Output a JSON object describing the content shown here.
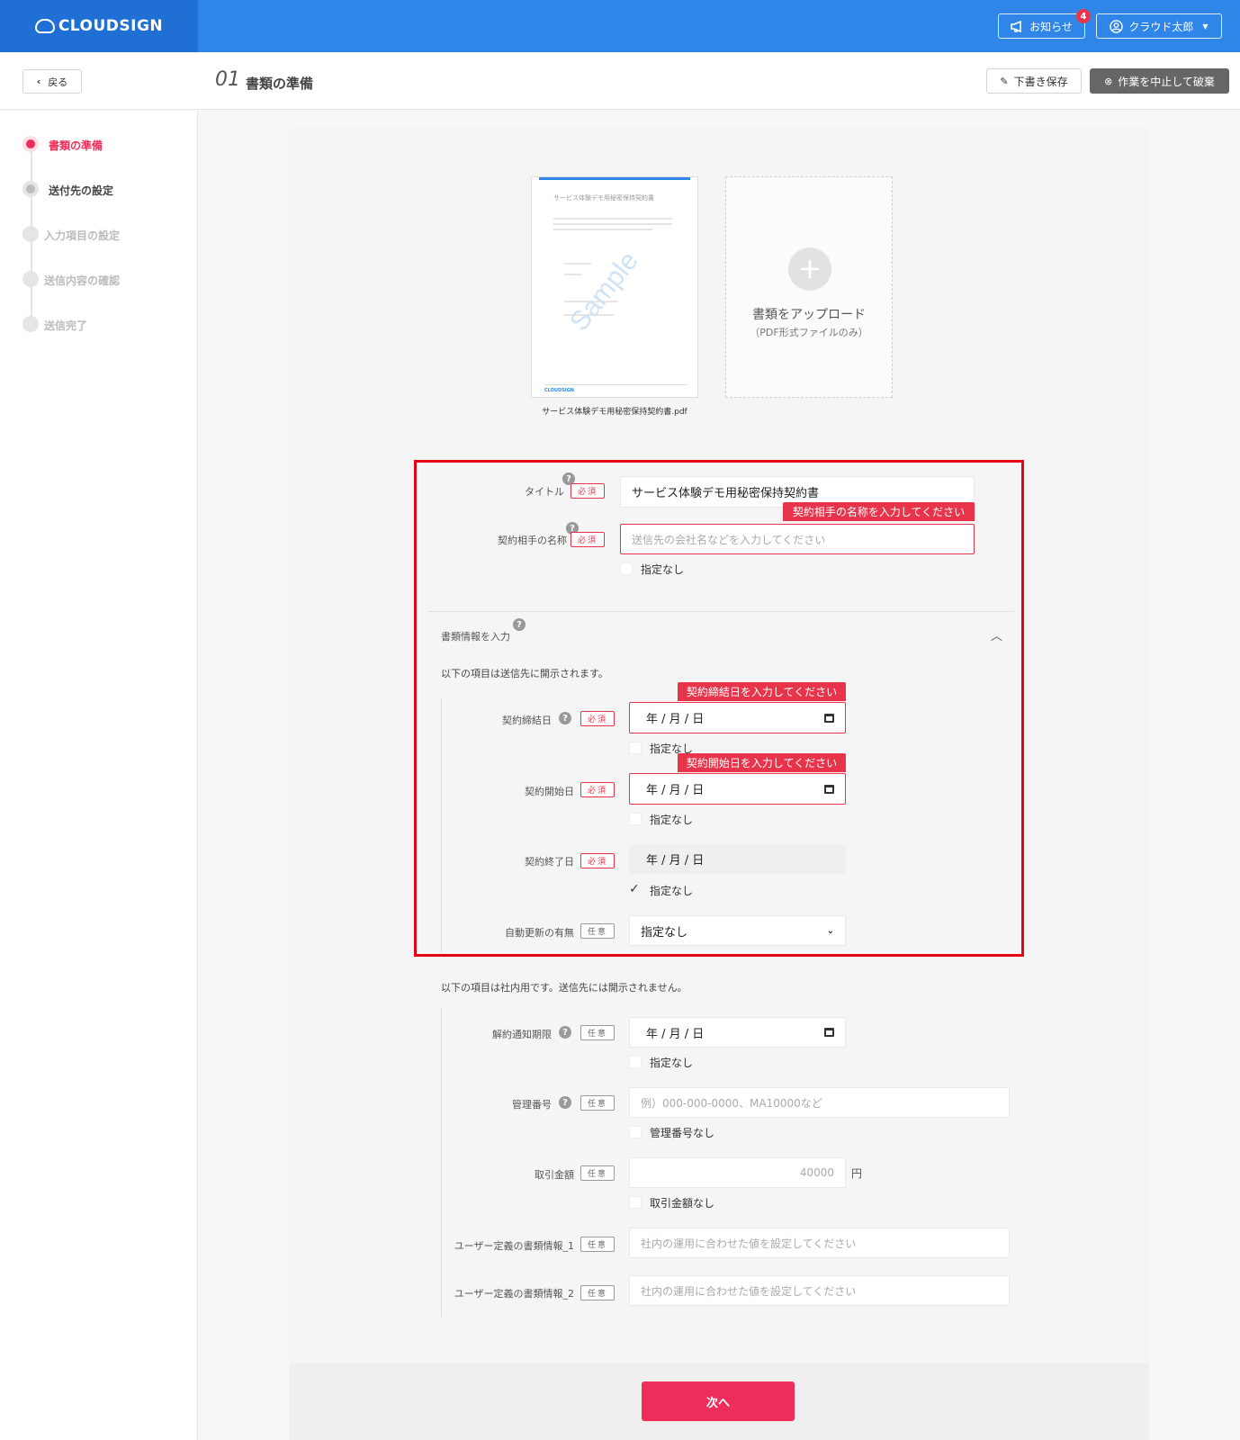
{
  "header": {
    "logo_text": "CLOUDSIGN",
    "notifications_label": "お知らせ",
    "notifications_count": "4",
    "user_label": "クラウド太郎"
  },
  "subheader": {
    "back_label": "戻る",
    "step_number": "01",
    "title": "書類の準備",
    "draft_label": "下書き保存",
    "discard_label": "作業を中止して破棄"
  },
  "steps": [
    {
      "label": "書類の準備",
      "state": "active"
    },
    {
      "label": "送付先の設定",
      "state": "next"
    },
    {
      "label": "入力項目の設定",
      "state": "pending"
    },
    {
      "label": "送信内容の確認",
      "state": "pending"
    },
    {
      "label": "送信完了",
      "state": "pending"
    }
  ],
  "document": {
    "thumb_title": "サービス体験デモ用秘密保持契約書",
    "watermark": "Sample",
    "filename": "サービス体験デモ用秘密保持契約書.pdf",
    "upload_label": "書類をアップロード",
    "upload_sub": "（PDF形式ファイルのみ）"
  },
  "form": {
    "required_tag": "必須",
    "optional_tag": "任意",
    "help_glyph": "?",
    "title_label": "タイトル",
    "title_value": "サービス体験デモ用秘密保持契約書",
    "partner_label": "契約相手の名称",
    "partner_error": "契約相手の名称を入力してください",
    "partner_placeholder": "送信先の会社名などを入力してください",
    "none_label": "指定なし",
    "doc_info_label": "書類情報を入力",
    "disclosed_note": "以下の項目は送信先に開示されます。",
    "sign_date_label": "契約締結日",
    "sign_date_error": "契約締結日を入力してください",
    "start_date_label": "契約開始日",
    "start_date_error": "契約開始日を入力してください",
    "end_date_label": "契約終了日",
    "date_placeholder": "年 / 月 / 日",
    "auto_renew_label": "自動更新の有無",
    "auto_renew_value": "指定なし",
    "internal_note": "以下の項目は社内用です。送信先には開示されません。",
    "cancel_notice_label": "解約通知期限",
    "mgmt_no_label": "管理番号",
    "mgmt_no_placeholder": "例）000-000-0000、MA10000など",
    "mgmt_no_none": "管理番号なし",
    "amount_label": "取引金額",
    "amount_placeholder": "40000",
    "amount_unit": "円",
    "amount_none": "取引金額なし",
    "user1_label": "ユーザー定義の書類情報_1",
    "user2_label": "ユーザー定義の書類情報_2",
    "user_placeholder": "社内の運用に合わせた値を設定してください"
  },
  "next_label": "次へ",
  "colors": {
    "brand_blue": "#2f86e8",
    "error_red": "#e8344a",
    "highlight_red": "#e20612",
    "next_button": "#ef2d5a"
  }
}
